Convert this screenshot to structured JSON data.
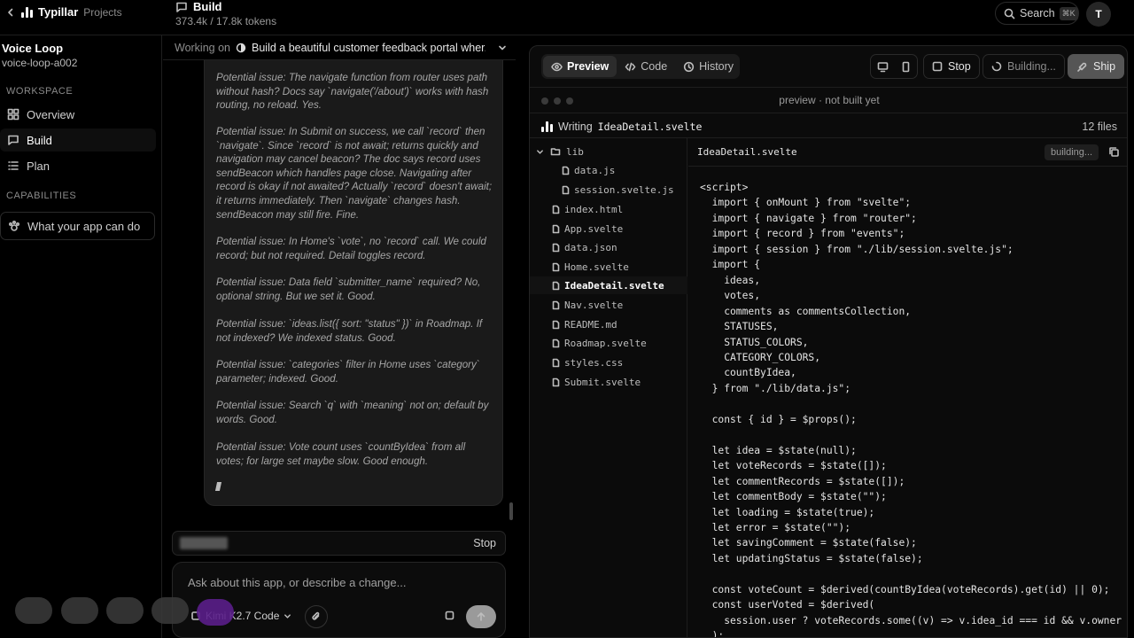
{
  "topbar": {
    "brand": "Typillar",
    "projects_link": "Projects",
    "section_title": "Build",
    "tokens": "373.4k / 17.8k tokens",
    "search_label": "Search",
    "search_shortcut": "⌘K",
    "avatar_initial": "T"
  },
  "sidebar": {
    "project_name": "Voice Loop",
    "project_id": "voice-loop-a002",
    "workspace_label": "WORKSPACE",
    "items": [
      {
        "label": "Overview",
        "icon": "grid-icon"
      },
      {
        "label": "Build",
        "icon": "chat-icon",
        "active": true
      },
      {
        "label": "Plan",
        "icon": "list-icon"
      }
    ],
    "capabilities_label": "CAPABILITIES",
    "capabilities_button": "What your app can do"
  },
  "chat": {
    "working_label": "Working on",
    "working_task": "Build a beautiful customer feedback portal wher...",
    "messages": [
      "Potential issue: The navigate function from router uses path without hash? Docs say `navigate('/about')` works with hash routing, no reload. Yes.",
      "Potential issue: In Submit on success, we call `record` then `navigate`. Since `record` is not await; returns quickly and navigation may cancel beacon? The doc says record uses sendBeacon which handles page close. Navigating after record is okay if not awaited? Actually `record` doesn't await; it returns immediately. Then `navigate` changes hash. sendBeacon may still fire. Fine.",
      "Potential issue: In Home's `vote`, no `record` call. We could record; but not required. Detail toggles record.",
      "Potential issue: Data field `submitter_name` required? No, optional string. But we set it. Good.",
      "Potential issue: `ideas.list({ sort: \"status\" })` in Roadmap. If not indexed? We indexed status. Good.",
      "Potential issue: `categories` filter in Home uses `category` parameter; indexed. Good.",
      "Potential issue: Search `q` with `meaning` not on; default by words. Good.",
      "Potential issue: Vote count uses `countByIdea` from all votes; for large set maybe slow. Good enough."
    ],
    "stop_label": "Stop",
    "composer_placeholder": "Ask about this app, or describe a change...",
    "model_label": "Kimi K2.7 Code"
  },
  "preview": {
    "tabs": [
      "Preview",
      "Code",
      "History"
    ],
    "stop_label": "Stop",
    "building_label": "Building...",
    "ship_label": "Ship",
    "url_text": "preview · not built yet",
    "writing_label": "Writing",
    "writing_file": "IdeaDetail.svelte",
    "files_count": "12 files",
    "tree": [
      {
        "name": "lib",
        "type": "folder",
        "depth": 0
      },
      {
        "name": "data.js",
        "type": "file",
        "depth": 1
      },
      {
        "name": "session.svelte.js",
        "type": "file",
        "depth": 1
      },
      {
        "name": "index.html",
        "type": "file",
        "depth": 0
      },
      {
        "name": "App.svelte",
        "type": "file",
        "depth": 0
      },
      {
        "name": "data.json",
        "type": "file",
        "depth": 0
      },
      {
        "name": "Home.svelte",
        "type": "file",
        "depth": 0
      },
      {
        "name": "IdeaDetail.svelte",
        "type": "file",
        "depth": 0,
        "selected": true
      },
      {
        "name": "Nav.svelte",
        "type": "file",
        "depth": 0
      },
      {
        "name": "README.md",
        "type": "file",
        "depth": 0
      },
      {
        "name": "Roadmap.svelte",
        "type": "file",
        "depth": 0
      },
      {
        "name": "styles.css",
        "type": "file",
        "depth": 0
      },
      {
        "name": "Submit.svelte",
        "type": "file",
        "depth": 0
      }
    ],
    "editor_file": "IdeaDetail.svelte",
    "editor_badge": "building...",
    "code_lines": [
      "<script>",
      "  import { onMount } from \"svelte\";",
      "  import { navigate } from \"router\";",
      "  import { record } from \"events\";",
      "  import { session } from \"./lib/session.svelte.js\";",
      "  import {",
      "    ideas,",
      "    votes,",
      "    comments as commentsCollection,",
      "    STATUSES,",
      "    STATUS_COLORS,",
      "    CATEGORY_COLORS,",
      "    countByIdea,",
      "  } from \"./lib/data.js\";",
      "",
      "  const { id } = $props();",
      "",
      "  let idea = $state(null);",
      "  let voteRecords = $state([]);",
      "  let commentRecords = $state([]);",
      "  let commentBody = $state(\"\");",
      "  let loading = $state(true);",
      "  let error = $state(\"\");",
      "  let savingComment = $state(false);",
      "  let updatingStatus = $state(false);",
      "",
      "  const voteCount = $derived(countByIdea(voteRecords).get(id) || 0);",
      "  const userVoted = $derived(",
      "    session.user ? voteRecords.some((v) => v.idea_id === id && v.owner === s",
      "  );"
    ]
  }
}
